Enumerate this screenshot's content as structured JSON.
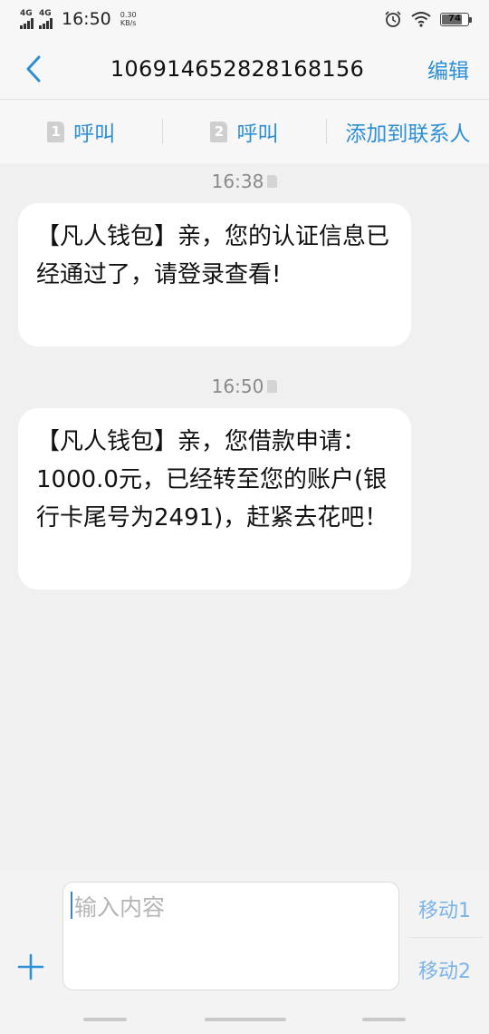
{
  "status_bar": {
    "sim1_network": "4G",
    "sim2_network": "4G",
    "time": "16:50",
    "speed_value": "0.30",
    "speed_unit": "KB/s",
    "battery": "74"
  },
  "header": {
    "title": "106914652828168156",
    "edit_label": "编辑"
  },
  "actions": {
    "call1_sim": "1",
    "call1_label": "呼叫",
    "call2_sim": "2",
    "call2_label": "呼叫",
    "add_contact_label": "添加到联系人"
  },
  "messages": [
    {
      "time": "16:38",
      "text": "【凡人钱包】亲，您的认证信息已经通过了，请登录查看!"
    },
    {
      "time": "16:50",
      "text": "【凡人钱包】亲，您借款申请：1000.0元，已经转至您的账户(银行卡尾号为2491)，赶紧去花吧！"
    }
  ],
  "composer": {
    "placeholder": "输入内容",
    "send_sim1": "移动1",
    "send_sim2": "移动2"
  },
  "colors": {
    "accent": "#2d8fd6",
    "send_disabled": "#7ab4e8",
    "background": "#f0f0f0",
    "bubble": "#ffffff"
  }
}
